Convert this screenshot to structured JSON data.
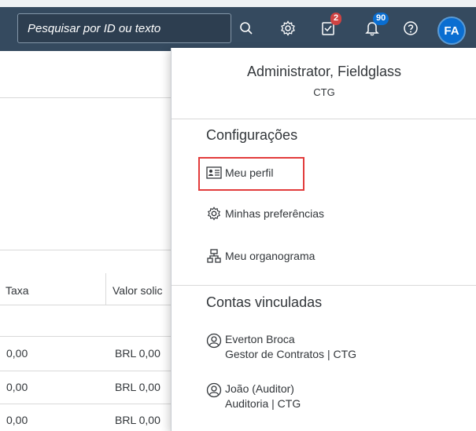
{
  "shell": {
    "search_placeholder": "Pesquisar por ID ou texto",
    "tasks_count": "2",
    "notifications_count": "90",
    "avatar_initials": "FA",
    "colors": {
      "shell_bg": "#354a5f",
      "accent": "#0a6ed1",
      "badge_red": "#d04343"
    }
  },
  "table": {
    "columns": [
      "Taxa",
      "Valor solic"
    ],
    "rows": [
      [
        "0,00",
        "BRL 0,00"
      ],
      [
        "0,00",
        "BRL 0,00"
      ],
      [
        "0,00",
        "BRL 0,00"
      ]
    ]
  },
  "popover": {
    "user_name": "Administrator, Fieldglass",
    "user_org": "CTG",
    "settings_title": "Configurações",
    "settings_items": [
      {
        "label": "Meu perfil",
        "icon": "profile-card-icon"
      },
      {
        "label": "Minhas preferências",
        "icon": "gear-icon"
      },
      {
        "label": "Meu organograma",
        "icon": "org-chart-icon"
      }
    ],
    "linked_title": "Contas vinculadas",
    "linked_accounts": [
      {
        "name": "Everton Broca",
        "role": "Gestor de Contratos | CTG",
        "icon": "user-circle-icon"
      },
      {
        "name": "João (Auditor)",
        "role": "Auditoria | CTG",
        "icon": "user-circle-icon"
      }
    ]
  }
}
